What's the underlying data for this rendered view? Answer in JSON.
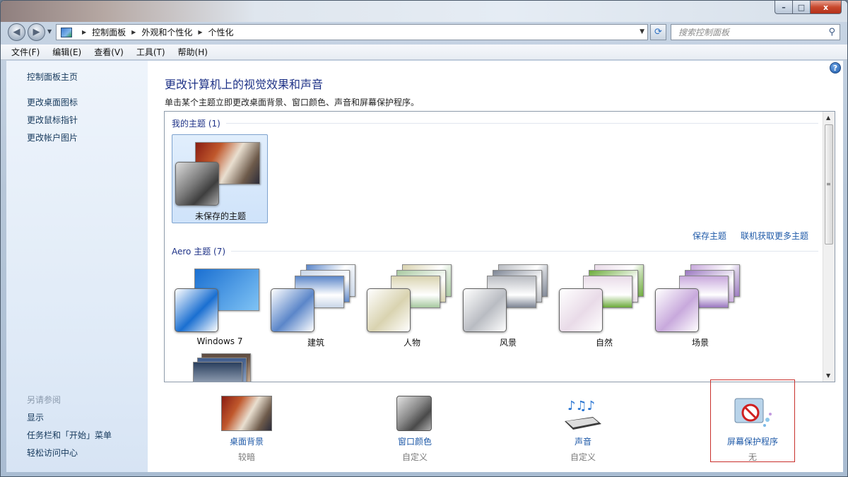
{
  "window": {
    "caption_buttons": {
      "minimize": "–",
      "maximize": "□",
      "close": "x"
    }
  },
  "address_bar": {
    "breadcrumbs": [
      "控制面板",
      "外观和个性化",
      "个性化"
    ],
    "search_placeholder": "搜索控制面板"
  },
  "menu": [
    "文件(F)",
    "编辑(E)",
    "查看(V)",
    "工具(T)",
    "帮助(H)"
  ],
  "sidebar": {
    "home_link": "控制面板主页",
    "links": [
      "更改桌面图标",
      "更改鼠标指针",
      "更改帐户图片"
    ],
    "see_also_heading": "另请参阅",
    "see_also_links": [
      "显示",
      "任务栏和「开始」菜单",
      "轻松访问中心"
    ]
  },
  "main": {
    "title": "更改计算机上的视觉效果和声音",
    "description": "单击某个主题立即更改桌面背景、窗口颜色、声音和屏幕保护程序。",
    "help_icon": "?"
  },
  "themes": {
    "my_themes_heading": "我的主题 (1)",
    "my_themes": [
      {
        "name": "未保存的主题",
        "selected": true
      }
    ],
    "save_theme_link": "保存主题",
    "get_more_link": "联机获取更多主题",
    "aero_heading": "Aero 主题 (7)",
    "aero_themes": [
      {
        "name": "Windows 7",
        "colors": [
          "#1a6fd1",
          "#7fc3f5"
        ]
      },
      {
        "name": "建筑",
        "colors": [
          "#5b86c9",
          "#c9d6e8"
        ]
      },
      {
        "name": "人物",
        "colors": [
          "#d9d3b0",
          "#a8c9a0"
        ]
      },
      {
        "name": "风景",
        "colors": [
          "#b9bcc2",
          "#7d8594"
        ]
      },
      {
        "name": "自然",
        "colors": [
          "#e9dbe8",
          "#6cab3a"
        ]
      },
      {
        "name": "场景",
        "colors": [
          "#c8a9dc",
          "#9a77c0"
        ]
      }
    ]
  },
  "bottom": [
    {
      "label": "桌面背景",
      "value": "较暗",
      "icon": "desktop-background-icon"
    },
    {
      "label": "窗口颜色",
      "value": "自定义",
      "icon": "window-color-icon"
    },
    {
      "label": "声音",
      "value": "自定义",
      "icon": "sound-icon"
    },
    {
      "label": "屏幕保护程序",
      "value": "无",
      "icon": "screen-saver-icon",
      "highlighted": true
    }
  ]
}
